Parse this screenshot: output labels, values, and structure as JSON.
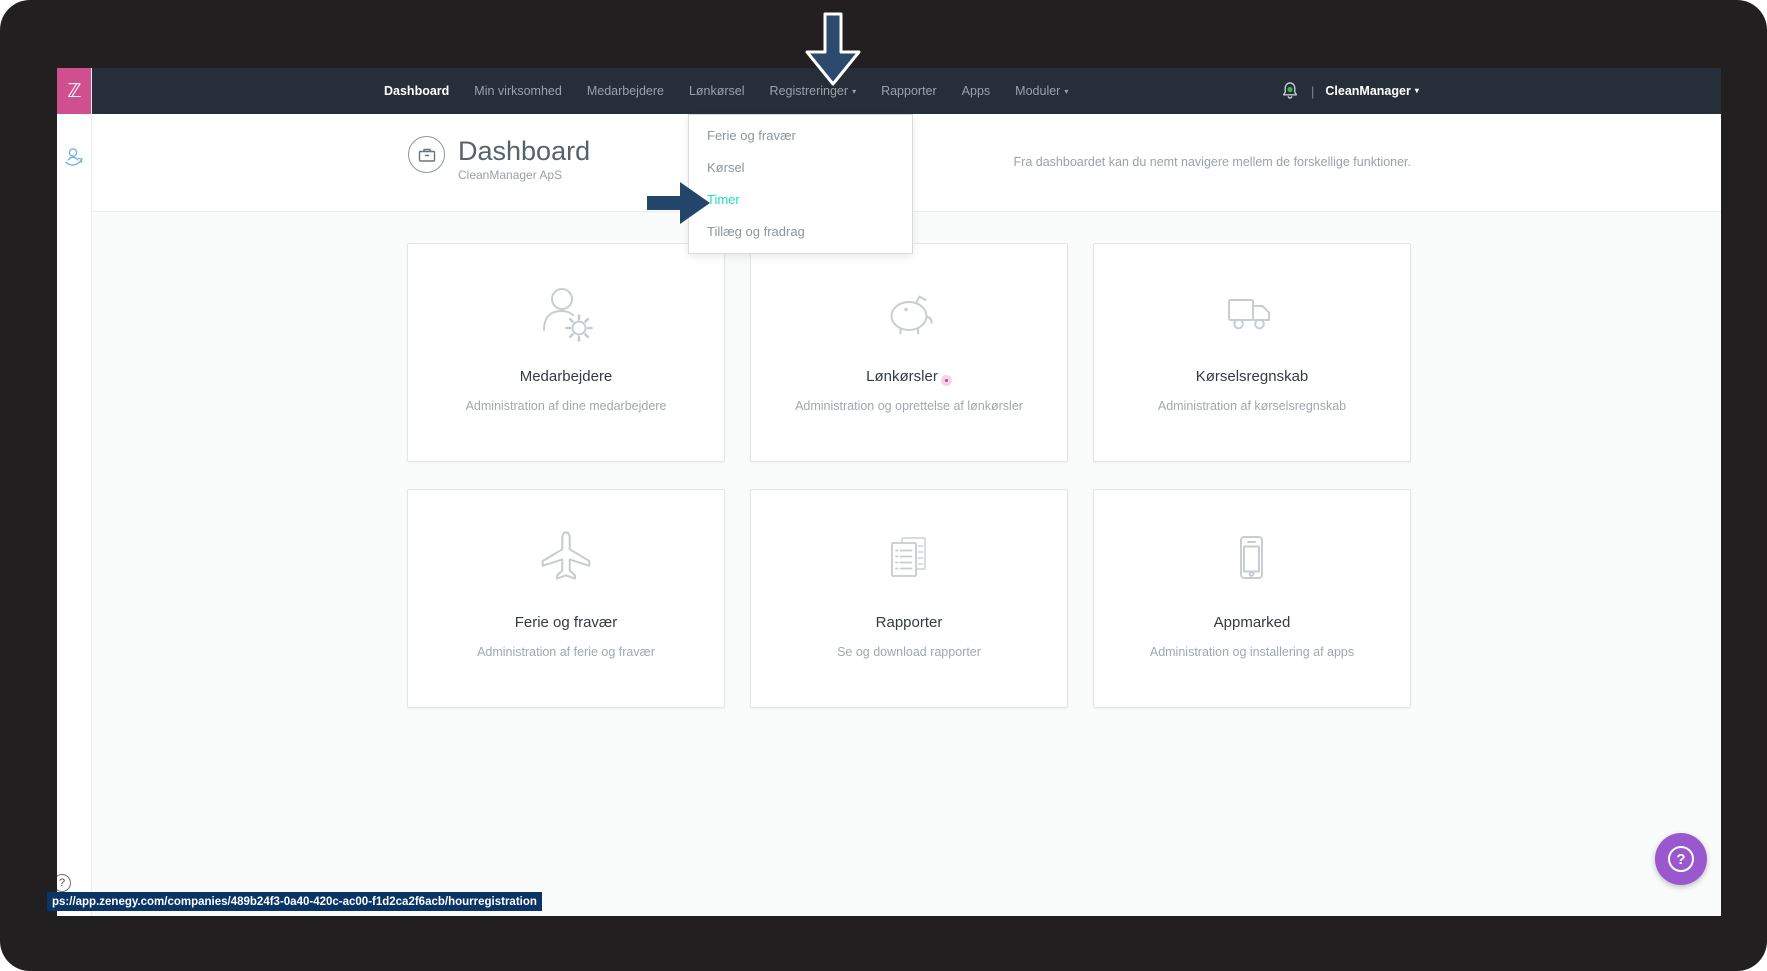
{
  "colors": {
    "navbar_bg": "#262f39",
    "logo_pink": "#d0508f",
    "accent_teal": "#1fe0b4",
    "badge_pink": "#c2417d",
    "badge_ring": "#f7d4e3",
    "arrow_navy": "#2c4a6d",
    "help_purple": "#9a58cf",
    "statusbar_bg": "#0a3366",
    "notification_green": "#3eb54b"
  },
  "sidebar": {
    "logo_glyph": "ℤ",
    "help_glyph": "?"
  },
  "navbar": {
    "caret_glyph": "▾",
    "separator": "|",
    "items": [
      {
        "label": "Dashboard"
      },
      {
        "label": "Min virksomhed"
      },
      {
        "label": "Medarbejdere"
      },
      {
        "label": "Lønkørsel"
      },
      {
        "label": "Registreringer"
      },
      {
        "label": "Rapporter"
      },
      {
        "label": "Apps"
      },
      {
        "label": "Moduler"
      }
    ],
    "user_menu_label": "CleanManager"
  },
  "dropdown": {
    "items": [
      {
        "label": "Ferie og fravær"
      },
      {
        "label": "Kørsel"
      },
      {
        "label": "Timer"
      },
      {
        "label": "Tillæg og fradrag"
      }
    ]
  },
  "header": {
    "title": "Dashboard",
    "subtitle": "CleanManager ApS",
    "description": "Fra dashboardet kan du nemt navigere mellem de forskellige funktioner."
  },
  "cards": [
    {
      "title": "Medarbejdere",
      "subtitle": "Administration af dine medarbejdere"
    },
    {
      "title": "Lønkørsler",
      "subtitle": "Administration og oprettelse af lønkørsler"
    },
    {
      "title": "Kørselsregnskab",
      "subtitle": "Administration af kørselsregnskab"
    },
    {
      "title": "Ferie og fravær",
      "subtitle": "Administration af ferie og fravær"
    },
    {
      "title": "Rapporter",
      "subtitle": "Se og download rapporter"
    },
    {
      "title": "Appmarked",
      "subtitle": "Administration og installering af apps"
    }
  ],
  "statusbar": {
    "url": "ps://app.zenegy.com/companies/489b24f3-0a40-420c-ac00-f1d2ca2f6acb/hourregistration"
  },
  "help_button": {
    "glyph": "?"
  }
}
